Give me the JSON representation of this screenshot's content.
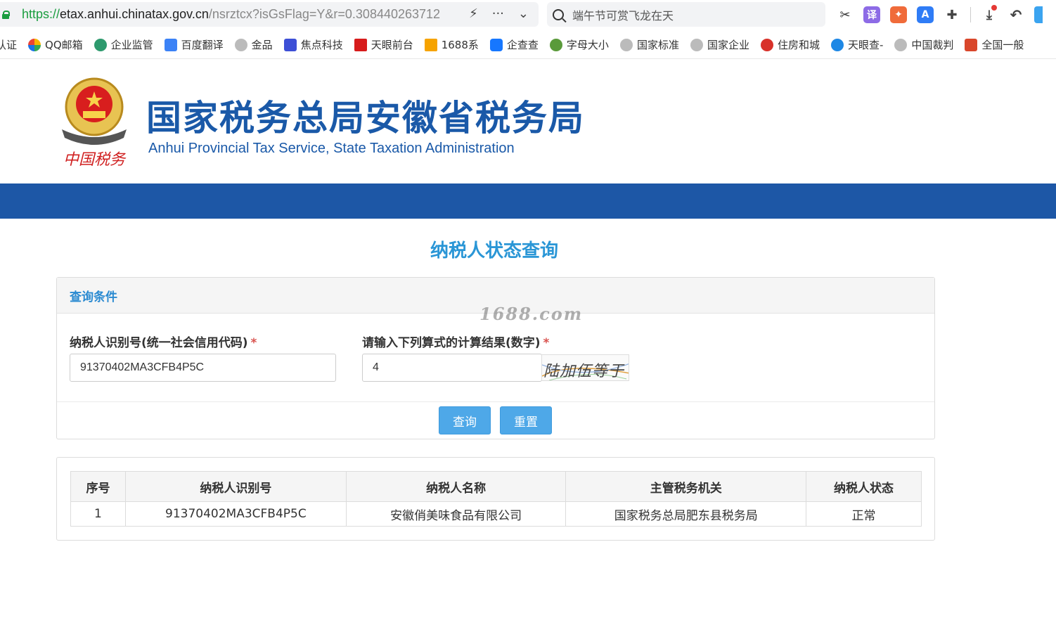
{
  "browser": {
    "url_scheme": "https://",
    "url_host": "etax.anhui.chinatax.gov.cn",
    "url_path": "/nsrztcx?isGsFlag=Y&r=0.308440263712",
    "search_text": "端午节可赏飞龙在天",
    "bookmarks": [
      "认证",
      "QQ邮箱",
      "企业监管",
      "百度翻译",
      "金品",
      "焦点科技",
      "天眼前台",
      "1688系",
      "企查查",
      "字母大小",
      "国家标准",
      "国家企业",
      "住房和城",
      "天眼查-",
      "中国裁判",
      "全国一般"
    ]
  },
  "header": {
    "title_cn": "国家税务总局安徽省税务局",
    "title_en": "Anhui Provincial Tax Service, State Taxation Administration",
    "emblem_text": "中国税务"
  },
  "page": {
    "title": "纳税人状态查询",
    "watermark": "1688.com"
  },
  "query": {
    "panel_title": "查询条件",
    "taxpayer_id_label": "纳税人识别号(统一社会信用代码)",
    "taxpayer_id_value": "91370402MA3CFB4P5C",
    "captcha_label": "请输入下列算式的计算结果(数字)",
    "captcha_value": "4",
    "captcha_text": "陆加伍等于",
    "required_mark": "*",
    "search_button": "查询",
    "reset_button": "重置"
  },
  "results": {
    "columns": [
      "序号",
      "纳税人识别号",
      "纳税人名称",
      "主管税务机关",
      "纳税人状态"
    ],
    "rows": [
      [
        "1",
        "91370402MA3CFB4P5C",
        "安徽俏美味食品有限公司",
        "国家税务总局肥东县税务局",
        "正常"
      ]
    ]
  }
}
